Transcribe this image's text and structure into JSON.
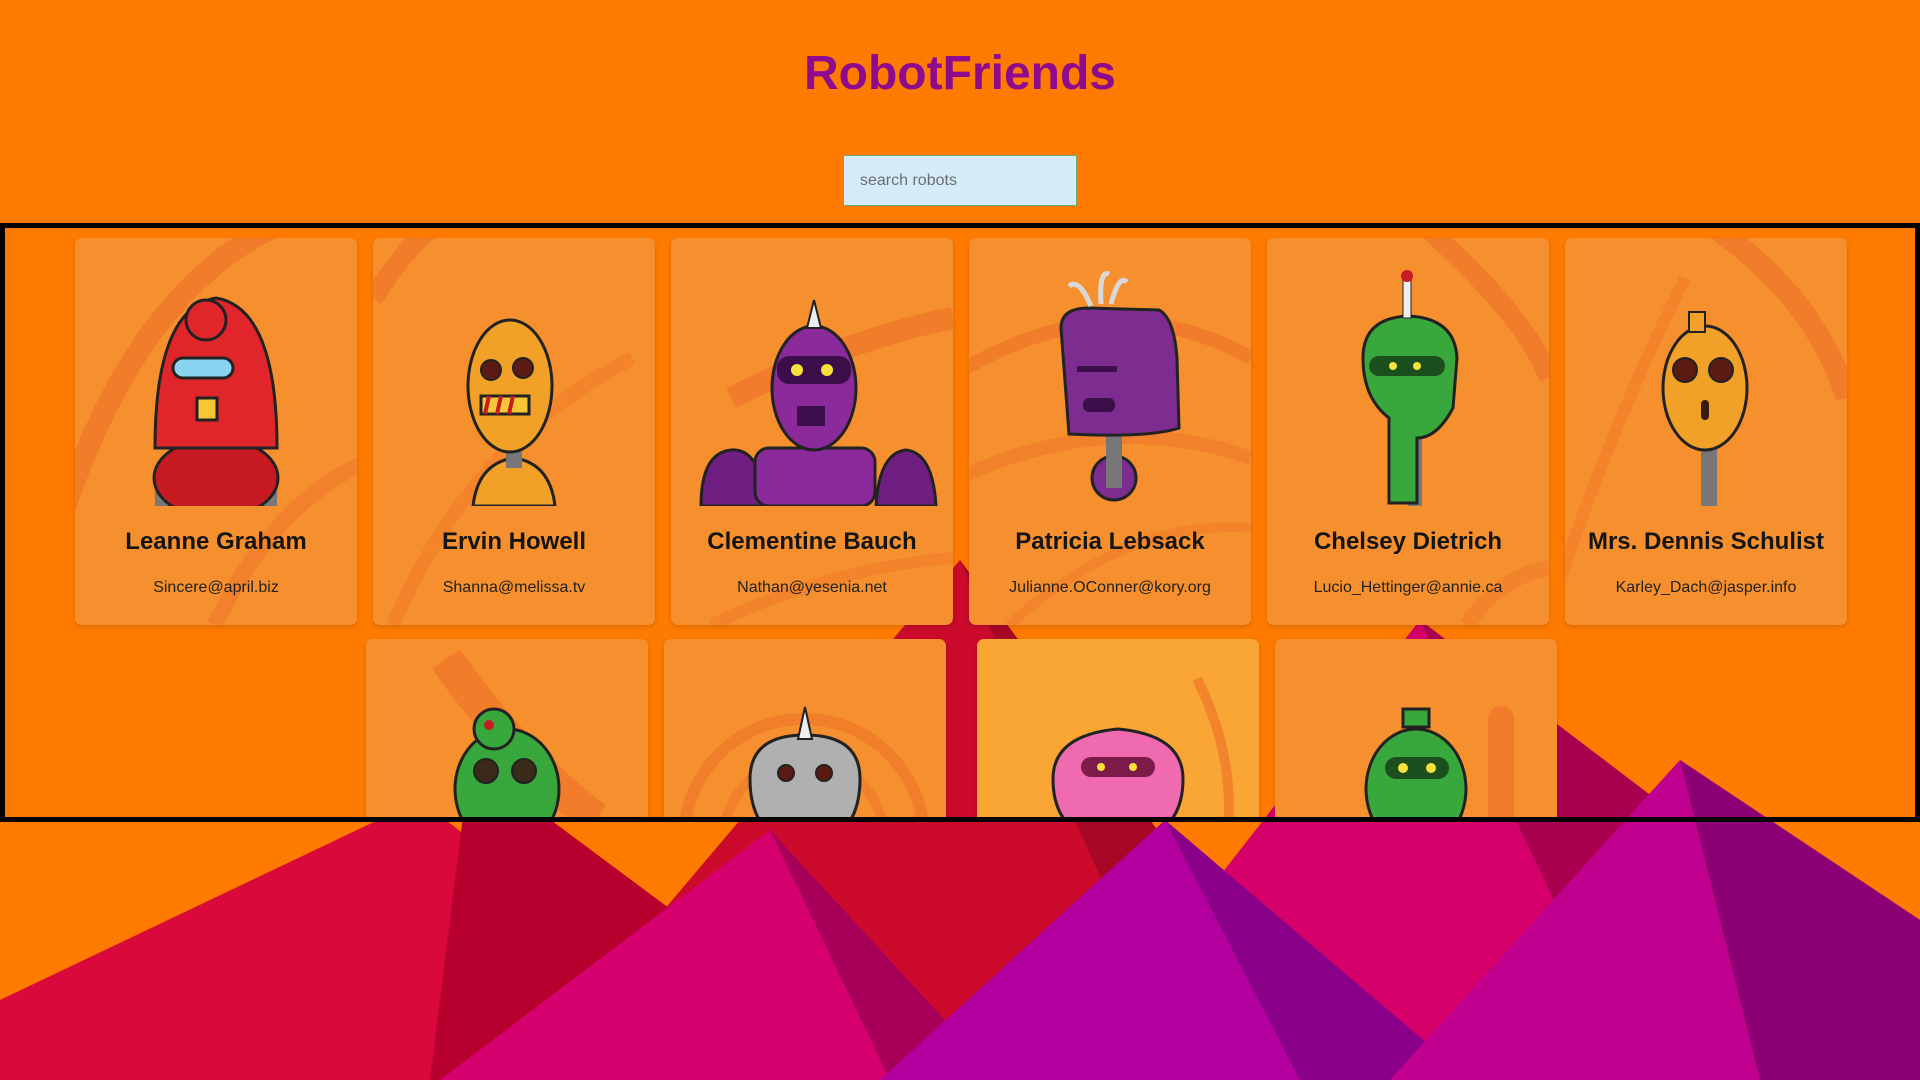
{
  "app": {
    "title": "RobotFriends"
  },
  "search": {
    "placeholder": "search robots",
    "value": ""
  },
  "colors": {
    "background": "#ff7b00",
    "title": "#8e0a8e",
    "card": "#f7922d",
    "search_bg": "#d4ecfa"
  },
  "robots": [
    {
      "name": "Leanne Graham",
      "email": "Sincere@april.biz",
      "robot_color": "#e0262a",
      "icon": "red-robot-icon"
    },
    {
      "name": "Ervin Howell",
      "email": "Shanna@melissa.tv",
      "robot_color": "#f2a128",
      "icon": "orange-robot-icon"
    },
    {
      "name": "Clementine Bauch",
      "email": "Nathan@yesenia.net",
      "robot_color": "#8b2a9a",
      "icon": "purple-robot-icon"
    },
    {
      "name": "Patricia Lebsack",
      "email": "Julianne.OConner@kory.org",
      "robot_color": "#7d2d8f",
      "icon": "purple-box-robot-icon"
    },
    {
      "name": "Chelsey Dietrich",
      "email": "Lucio_Hettinger@annie.ca",
      "robot_color": "#38a83c",
      "icon": "green-robot-icon"
    },
    {
      "name": "Mrs. Dennis Schulist",
      "email": "Karley_Dach@jasper.info",
      "robot_color": "#f2a128",
      "icon": "orange-egg-robot-icon"
    },
    {
      "name": "",
      "email": "",
      "robot_color": "#38a83c",
      "icon": "green-round-robot-icon"
    },
    {
      "name": "",
      "email": "",
      "robot_color": "#b0b0b0",
      "icon": "grey-robot-icon"
    },
    {
      "name": "",
      "email": "",
      "robot_color": "#f06ab0",
      "icon": "pink-robot-icon"
    },
    {
      "name": "",
      "email": "",
      "robot_color": "#38a83c",
      "icon": "green-hat-robot-icon"
    }
  ]
}
